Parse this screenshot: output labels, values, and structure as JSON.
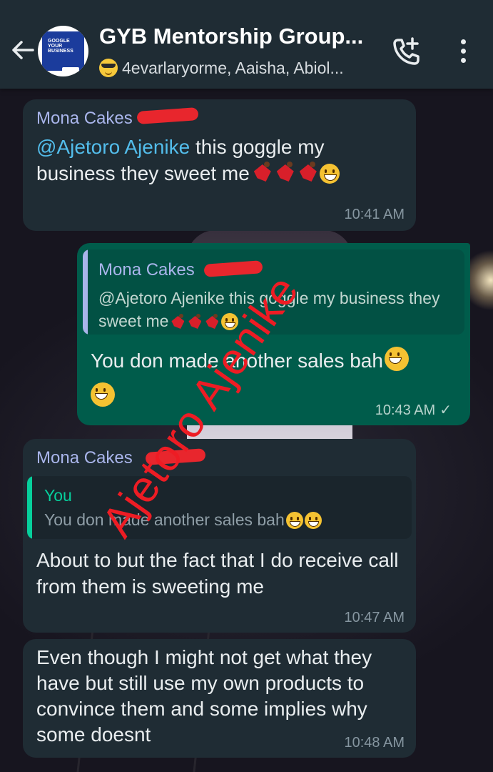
{
  "header": {
    "title": "GYB Mentorship Group...",
    "subtitle": "4evarlaryorme, Aaisha, Abiol...",
    "avatar_text": "GOOGLE YOUR BUSINESS"
  },
  "messages": [
    {
      "sender": "Mona Cakes",
      "mention": "@Ajetoro Ajenike",
      "text": " this goggle my business they sweet me",
      "time": "10:41 AM"
    },
    {
      "quote_sender": "Mona Cakes",
      "quote_text": "@Ajetoro Ajenike this goggle my business they sweet me",
      "text": "You don made another sales bah",
      "time": "10:43 AM"
    },
    {
      "sender": "Mona Cakes",
      "quote_sender": "You",
      "quote_text": "You don made another sales bah",
      "text": "About to but the fact that I do receive call from them is sweeting me",
      "time": "10:47 AM"
    },
    {
      "text": "Even though I might not get what they have but still use my own products to convince them and some implies why some doesnt",
      "time": "10:48 AM"
    }
  ],
  "watermark": "Ajetoro Ajenike",
  "colors": {
    "header_bg": "#1f2c34",
    "incoming_bubble": "#1f2c34",
    "outgoing_bubble": "#005c4b",
    "mention": "#53bdeb",
    "watermark": "#ee1c24"
  }
}
